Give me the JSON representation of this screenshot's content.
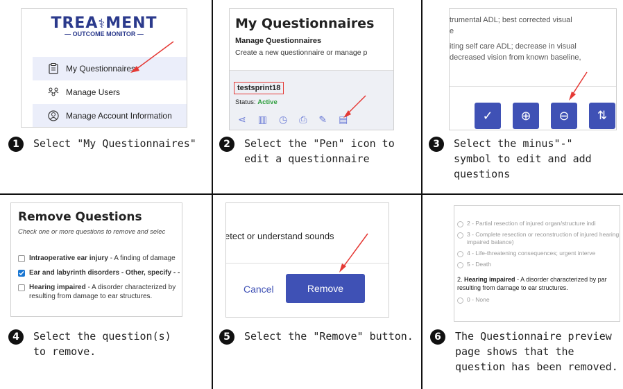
{
  "steps": [
    {
      "num": "1",
      "text": "Select \"My Questionnaires\""
    },
    {
      "num": "2",
      "text": "Select the \"Pen\" icon to edit a questionnaire"
    },
    {
      "num": "3",
      "text": "Select the minus\"-\" symbol to edit and add questions"
    },
    {
      "num": "4",
      "text": "Select the question(s) to remove."
    },
    {
      "num": "5",
      "text": "Select the \"Remove\" button."
    },
    {
      "num": "6",
      "text": "The Questionnaire preview page shows that the question has been removed."
    }
  ],
  "panel1": {
    "logo_main": "TREA⁣MENT",
    "logo_left": "TREA",
    "logo_right": "MENT",
    "logo_sub": "OUTCOME MONITOR",
    "menu": [
      "My Questionnaires",
      "Manage Users",
      "Manage Account Information"
    ]
  },
  "panel2": {
    "title": "My Questionnaires",
    "subtitle": "Manage Questionnaires",
    "description": "Create a new questionnaire or manage p",
    "item_name": "testsprint18",
    "status_label": "Status:",
    "status_value": "Active"
  },
  "panel3": {
    "lines": [
      "trumental ADL; best corrected visual",
      "e",
      "iting self care ADL; decrease in visual",
      "decreased vision from known baseline,"
    ]
  },
  "panel4": {
    "title": "Remove Questions",
    "instruction": "Check one or more questions to remove and selec",
    "questions": [
      {
        "bold": "Intraoperative ear injury",
        "rest": " - A finding of damage",
        "checked": false
      },
      {
        "bold": "Ear and labyrinth disorders - Other, specify",
        "rest": " - -",
        "checked": true
      },
      {
        "bold": "Hearing impaired",
        "rest": " - A disorder characterized by resulting from damage to ear structures.",
        "checked": false
      }
    ]
  },
  "panel5": {
    "text": "etect or understand sounds",
    "cancel": "Cancel",
    "remove": "Remove"
  },
  "panel6": {
    "options": [
      "2 - Partial resection of injured organ/structure indi",
      "3 - Complete resection or reconstruction of injured hearing; impaired balance)",
      "4 - Life-threatening consequences; urgent interve",
      "5 - Death"
    ],
    "question_num": "2.",
    "question_bold": "Hearing impaired",
    "question_rest": " - A disorder characterized by par resulting from damage to ear structures.",
    "next_option": "0 - None"
  },
  "colors": {
    "accent": "#3f51b5",
    "arrow": "#e53935",
    "active": "#2e9e3e",
    "highlight": "#ebeefa"
  }
}
